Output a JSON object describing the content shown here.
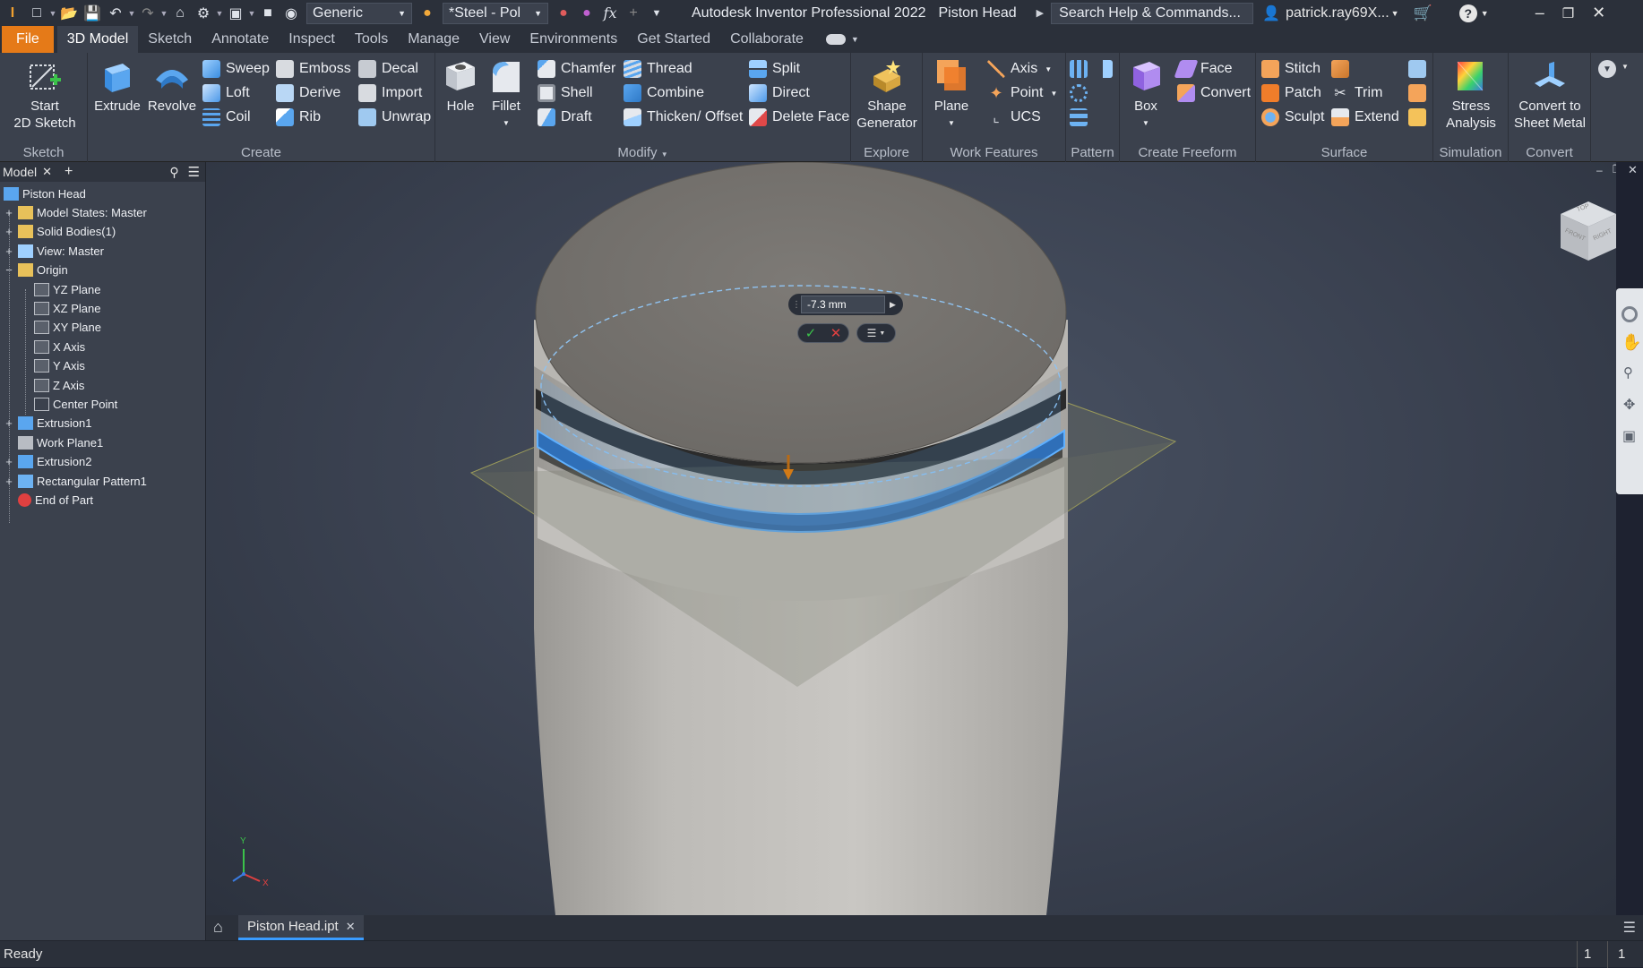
{
  "titlebar": {
    "material_dropdown": "Generic",
    "appearance_dropdown": "*Steel - Pol",
    "app_title": "Autodesk Inventor Professional 2022",
    "doc_title": "Piston Head",
    "search_placeholder": "Search Help & Commands...",
    "user": "patrick.ray69X..."
  },
  "tabs": [
    "File",
    "3D Model",
    "Sketch",
    "Annotate",
    "Inspect",
    "Tools",
    "Manage",
    "View",
    "Environments",
    "Get Started",
    "Collaborate"
  ],
  "ribbon": {
    "sketch": {
      "title": "Sketch",
      "start_2d_sketch": "Start\n2D Sketch"
    },
    "create": {
      "title": "Create",
      "extrude": "Extrude",
      "revolve": "Revolve",
      "sweep": "Sweep",
      "emboss": "Emboss",
      "decal": "Decal",
      "loft": "Loft",
      "derive": "Derive",
      "import": "Import",
      "coil": "Coil",
      "rib": "Rib",
      "unwrap": "Unwrap"
    },
    "modify": {
      "title": "Modify",
      "hole": "Hole",
      "fillet": "Fillet",
      "chamfer": "Chamfer",
      "thread": "Thread",
      "split": "Split",
      "shell": "Shell",
      "combine": "Combine",
      "direct": "Direct",
      "draft": "Draft",
      "thicken_offset": "Thicken/ Offset",
      "delete_face": "Delete Face"
    },
    "explore": {
      "title": "Explore",
      "shape_generator": "Shape\nGenerator"
    },
    "work_features": {
      "title": "Work Features",
      "plane": "Plane",
      "axis": "Axis",
      "point": "Point",
      "ucs": "UCS"
    },
    "pattern": {
      "title": "Pattern"
    },
    "create_freeform": {
      "title": "Create Freeform",
      "box": "Box",
      "face": "Face",
      "convert": "Convert"
    },
    "surface": {
      "title": "Surface",
      "stitch": "Stitch",
      "patch": "Patch",
      "trim": "Trim",
      "sculpt": "Sculpt",
      "extend": "Extend"
    },
    "simulation": {
      "title": "Simulation",
      "stress_analysis": "Stress\nAnalysis"
    },
    "convert": {
      "title": "Convert",
      "convert_to_sheet_metal": "Convert to\nSheet Metal"
    }
  },
  "browser": {
    "tab_label": "Model",
    "items": [
      {
        "label": "Piston Head",
        "indent": 0,
        "expander": ""
      },
      {
        "label": "Model States: Master",
        "indent": 0,
        "expander": "+"
      },
      {
        "label": "Solid Bodies(1)",
        "indent": 0,
        "expander": "+"
      },
      {
        "label": "View: Master",
        "indent": 0,
        "expander": "+"
      },
      {
        "label": "Origin",
        "indent": 0,
        "expander": "−"
      },
      {
        "label": "YZ Plane",
        "indent": 1,
        "expander": ""
      },
      {
        "label": "XZ Plane",
        "indent": 1,
        "expander": ""
      },
      {
        "label": "XY Plane",
        "indent": 1,
        "expander": ""
      },
      {
        "label": "X Axis",
        "indent": 1,
        "expander": ""
      },
      {
        "label": "Y Axis",
        "indent": 1,
        "expander": ""
      },
      {
        "label": "Z Axis",
        "indent": 1,
        "expander": ""
      },
      {
        "label": "Center Point",
        "indent": 1,
        "expander": ""
      },
      {
        "label": "Extrusion1",
        "indent": 0,
        "expander": "+"
      },
      {
        "label": "Work Plane1",
        "indent": 0,
        "expander": ""
      },
      {
        "label": "Extrusion2",
        "indent": 0,
        "expander": "+"
      },
      {
        "label": "Rectangular Pattern1",
        "indent": 0,
        "expander": "+"
      },
      {
        "label": "End of Part",
        "indent": 0,
        "expander": ""
      }
    ]
  },
  "viewport": {
    "offset_value": "-7.3",
    "offset_unit": "mm",
    "axis_x": "X",
    "axis_y": "Y",
    "viewcube_top": "TOP",
    "viewcube_front": "FRONT",
    "viewcube_right": "RIGHT"
  },
  "document_tab": "Piston Head.ipt",
  "status": {
    "text": "Ready",
    "count1": "1",
    "count2": "1"
  },
  "colors": {
    "accent_orange": "#e57a18",
    "selection_blue": "#4a9cff"
  }
}
